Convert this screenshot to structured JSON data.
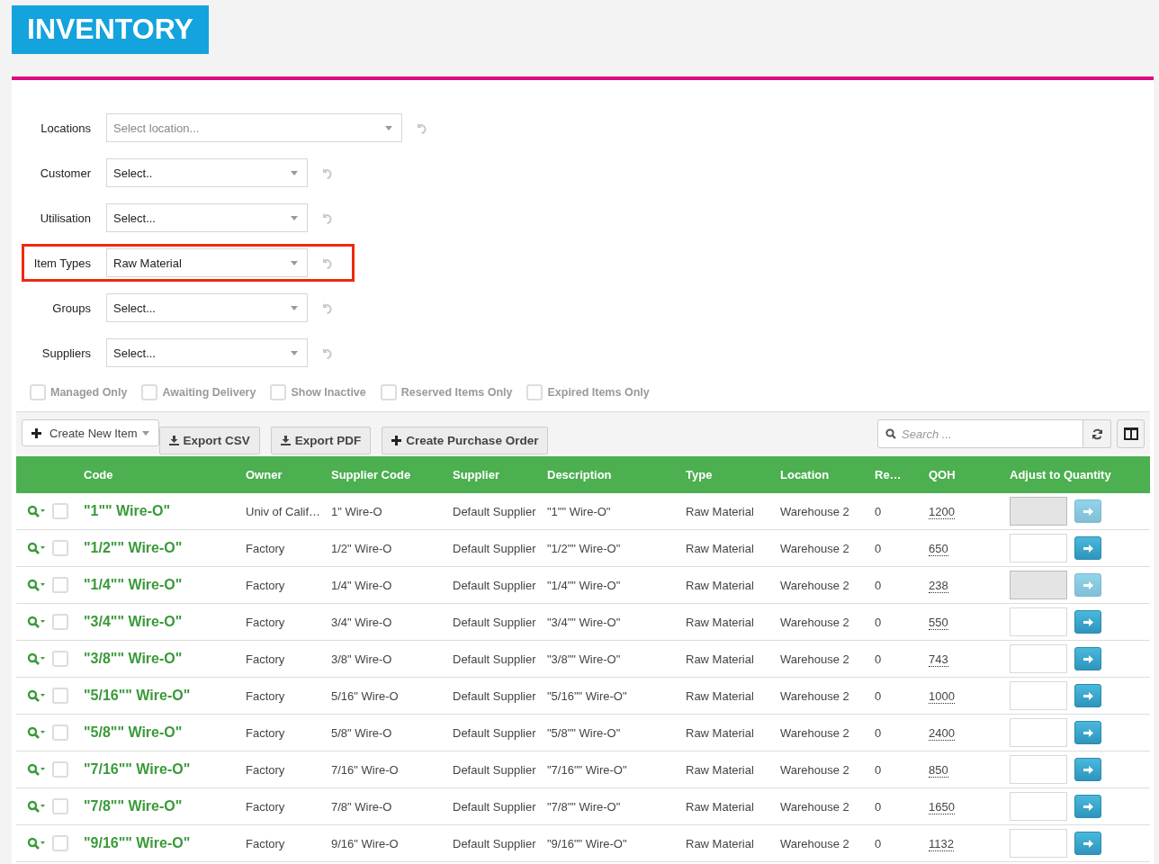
{
  "header": {
    "title": "INVENTORY"
  },
  "filters": [
    {
      "label": "Locations",
      "placeholder": "Select location...",
      "wide": true,
      "highlighted": false
    },
    {
      "label": "Customer",
      "value": "Select..",
      "wide": false,
      "highlighted": false
    },
    {
      "label": "Utilisation",
      "value": "Select...",
      "wide": false,
      "highlighted": false
    },
    {
      "label": "Item Types",
      "value": "Raw Material",
      "wide": false,
      "highlighted": true
    },
    {
      "label": "Groups",
      "value": "Select...",
      "wide": false,
      "highlighted": false
    },
    {
      "label": "Suppliers",
      "value": "Select...",
      "wide": false,
      "highlighted": false
    }
  ],
  "options": [
    {
      "label": "Managed Only",
      "checked": false,
      "disabled": true
    },
    {
      "label": "Awaiting Delivery",
      "checked": false,
      "disabled": true
    },
    {
      "label": "Show Inactive",
      "checked": false,
      "disabled": true
    },
    {
      "label": "Reserved Items Only",
      "checked": false,
      "disabled": true
    },
    {
      "label": "Expired Items Only",
      "checked": false,
      "disabled": true
    }
  ],
  "toolbar": {
    "create_item": "Create New Item",
    "buttons": [
      "Export CSV",
      "Export PDF",
      "Create Purchase Order"
    ],
    "search": {
      "placeholder": "Search ..."
    }
  },
  "table": {
    "columns": [
      "Code",
      "Owner",
      "Supplier Code",
      "Supplier",
      "Description",
      "Type",
      "Location",
      "Re…",
      "QOH",
      "Adjust to Quantity"
    ],
    "rows": [
      {
        "code": "\"1\"\" Wire-O\"",
        "owner": "Univ of Calif…",
        "supplier_code": "1\" Wire-O",
        "supplier": "Default Supplier",
        "description": "\"1\"\" Wire-O\"",
        "type": "Raw Material",
        "location": "Warehouse 2",
        "reserved": "0",
        "qoh": "1200",
        "checked": false,
        "disabled": true
      },
      {
        "code": "\"1/2\"\" Wire-O\"",
        "owner": "Factory",
        "supplier_code": "1/2\" Wire-O",
        "supplier": "Default Supplier",
        "description": "\"1/2\"\" Wire-O\"",
        "type": "Raw Material",
        "location": "Warehouse 2",
        "reserved": "0",
        "qoh": "650",
        "checked": false,
        "disabled": false
      },
      {
        "code": "\"1/4\"\" Wire-O\"",
        "owner": "Factory",
        "supplier_code": "1/4\" Wire-O",
        "supplier": "Default Supplier",
        "description": "\"1/4\"\" Wire-O\"",
        "type": "Raw Material",
        "location": "Warehouse 2",
        "reserved": "0",
        "qoh": "238",
        "checked": false,
        "disabled": true
      },
      {
        "code": "\"3/4\"\" Wire-O\"",
        "owner": "Factory",
        "supplier_code": "3/4\" Wire-O",
        "supplier": "Default Supplier",
        "description": "\"3/4\"\" Wire-O\"",
        "type": "Raw Material",
        "location": "Warehouse 2",
        "reserved": "0",
        "qoh": "550",
        "checked": false,
        "disabled": false
      },
      {
        "code": "\"3/8\"\" Wire-O\"",
        "owner": "Factory",
        "supplier_code": "3/8\" Wire-O",
        "supplier": "Default Supplier",
        "description": "\"3/8\"\" Wire-O\"",
        "type": "Raw Material",
        "location": "Warehouse 2",
        "reserved": "0",
        "qoh": "743",
        "checked": false,
        "disabled": false
      },
      {
        "code": "\"5/16\"\" Wire-O\"",
        "owner": "Factory",
        "supplier_code": "5/16\" Wire-O",
        "supplier": "Default Supplier",
        "description": "\"5/16\"\" Wire-O\"",
        "type": "Raw Material",
        "location": "Warehouse 2",
        "reserved": "0",
        "qoh": "1000",
        "checked": false,
        "disabled": false
      },
      {
        "code": "\"5/8\"\" Wire-O\"",
        "owner": "Factory",
        "supplier_code": "5/8\" Wire-O",
        "supplier": "Default Supplier",
        "description": "\"5/8\"\" Wire-O\"",
        "type": "Raw Material",
        "location": "Warehouse 2",
        "reserved": "0",
        "qoh": "2400",
        "checked": false,
        "disabled": false
      },
      {
        "code": "\"7/16\"\" Wire-O\"",
        "owner": "Factory",
        "supplier_code": "7/16\" Wire-O",
        "supplier": "Default Supplier",
        "description": "\"7/16\"\" Wire-O\"",
        "type": "Raw Material",
        "location": "Warehouse 2",
        "reserved": "0",
        "qoh": "850",
        "checked": false,
        "disabled": false
      },
      {
        "code": "\"7/8\"\" Wire-O\"",
        "owner": "Factory",
        "supplier_code": "7/8\" Wire-O",
        "supplier": "Default Supplier",
        "description": "\"7/8\"\" Wire-O\"",
        "type": "Raw Material",
        "location": "Warehouse 2",
        "reserved": "0",
        "qoh": "1650",
        "checked": false,
        "disabled": false
      },
      {
        "code": "\"9/16\"\" Wire-O\"",
        "owner": "Factory",
        "supplier_code": "9/16\" Wire-O",
        "supplier": "Default Supplier",
        "description": "\"9/16\"\" Wire-O\"",
        "type": "Raw Material",
        "location": "Warehouse 2",
        "reserved": "0",
        "qoh": "1132",
        "checked": false,
        "disabled": false
      }
    ]
  }
}
